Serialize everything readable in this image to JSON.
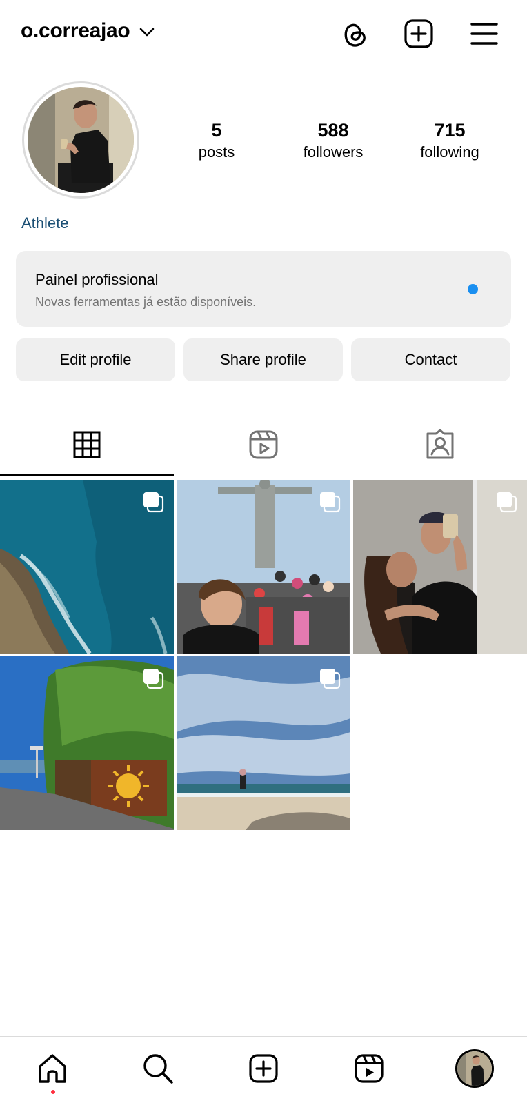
{
  "header": {
    "username": "o.correajao",
    "icons": [
      "threads-icon",
      "create-post-icon",
      "menu-icon"
    ]
  },
  "profile": {
    "stats": [
      {
        "value": "5",
        "label": "posts"
      },
      {
        "value": "588",
        "label": "followers"
      },
      {
        "value": "715",
        "label": "following"
      }
    ],
    "category": "Athlete"
  },
  "panel": {
    "title": "Painel profissional",
    "subtitle": "Novas ferramentas já estão disponíveis.",
    "dot_color": "#1a8ff0"
  },
  "buttons": {
    "edit": "Edit profile",
    "share": "Share profile",
    "contact": "Contact"
  },
  "tabs": [
    "grid-icon",
    "reels-icon",
    "tagged-icon"
  ],
  "posts": [
    {
      "name": "post-ocean-cliff",
      "multi": true
    },
    {
      "name": "post-christ-redeemer",
      "multi": true
    },
    {
      "name": "post-mirror-selfie",
      "multi": true
    },
    {
      "name": "post-sun-mural-road",
      "multi": true
    },
    {
      "name": "post-beach",
      "multi": true
    }
  ],
  "nav": [
    "home-icon",
    "search-icon",
    "create-icon",
    "reels-icon",
    "profile-avatar"
  ],
  "colors": {
    "accent": "#1a8ff0",
    "link": "#1b4f74",
    "button_bg": "#efefef",
    "notification": "#ff3040"
  }
}
